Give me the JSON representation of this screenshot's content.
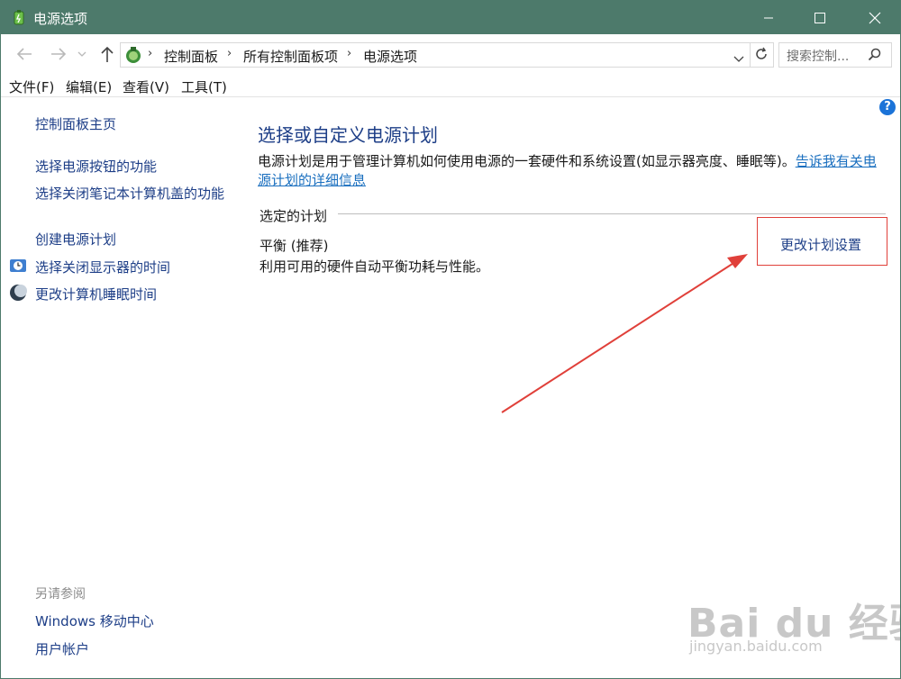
{
  "window": {
    "title": "电源选项"
  },
  "address": {
    "crumbs": [
      "控制面板",
      "所有控制面板项",
      "电源选项"
    ],
    "search_placeholder": "搜索控制..."
  },
  "menubar": {
    "items": [
      "文件(F)",
      "编辑(E)",
      "查看(V)",
      "工具(T)"
    ]
  },
  "sidebar": {
    "home": "控制面板主页",
    "links": [
      "选择电源按钮的功能",
      "选择关闭笔记本计算机盖的功能",
      "创建电源计划",
      "选择关闭显示器的时间",
      "更改计算机睡眠时间"
    ],
    "see_also_title": "另请参阅",
    "see_also": [
      "Windows 移动中心",
      "用户帐户"
    ]
  },
  "main": {
    "heading": "选择或自定义电源计划",
    "description": "电源计划是用于管理计算机如何使用电源的一套硬件和系统设置(如显示器亮度、睡眠等)。",
    "more_link": "告诉我有关电源计划的详细信息",
    "section_label": "选定的计划",
    "plan_name": "平衡 (推荐)",
    "plan_desc": "利用可用的硬件自动平衡功耗与性能。",
    "change_link": "更改计划设置",
    "help": "?"
  },
  "watermark": {
    "line1": "Bai du 经验",
    "line2": "jingyan.baidu.com"
  },
  "colors": {
    "titlebar": "#4d7a6b",
    "link": "#1d3e87",
    "annotation": "#e0403a"
  }
}
